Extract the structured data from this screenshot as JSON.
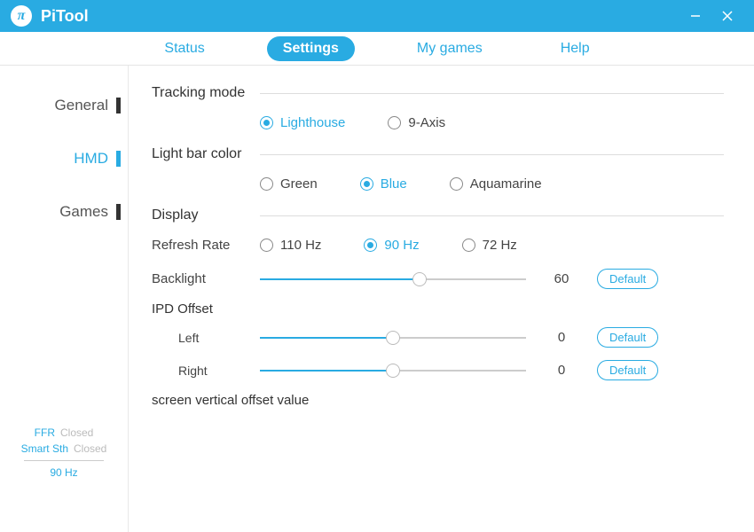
{
  "app": {
    "name": "PiTool"
  },
  "nav": {
    "status": "Status",
    "settings": "Settings",
    "mygames": "My games",
    "help": "Help"
  },
  "sidebar": {
    "general": "General",
    "hmd": "HMD",
    "games": "Games",
    "status": {
      "ffr_label": "FFR",
      "ffr_value": "Closed",
      "smartsth_label": "Smart Sth",
      "smartsth_value": "Closed",
      "hz": "90 Hz"
    }
  },
  "sections": {
    "tracking": {
      "title": "Tracking mode",
      "lighthouse": "Lighthouse",
      "nineaxis": "9-Axis"
    },
    "lightbar": {
      "title": "Light bar color",
      "green": "Green",
      "blue": "Blue",
      "aquamarine": "Aquamarine"
    },
    "display": {
      "title": "Display",
      "refresh_label": "Refresh Rate",
      "hz110": "110 Hz",
      "hz90": "90 Hz",
      "hz72": "72 Hz",
      "backlight_label": "Backlight",
      "backlight_value": "60",
      "ipd_title": "IPD Offset",
      "ipd_left_label": "Left",
      "ipd_left_value": "0",
      "ipd_right_label": "Right",
      "ipd_right_value": "0",
      "vertical_offset_title": "screen vertical offset value"
    }
  },
  "buttons": {
    "default": "Default"
  },
  "sliders": {
    "backlight_pct": 60,
    "ipd_left_pct": 50,
    "ipd_right_pct": 50
  }
}
